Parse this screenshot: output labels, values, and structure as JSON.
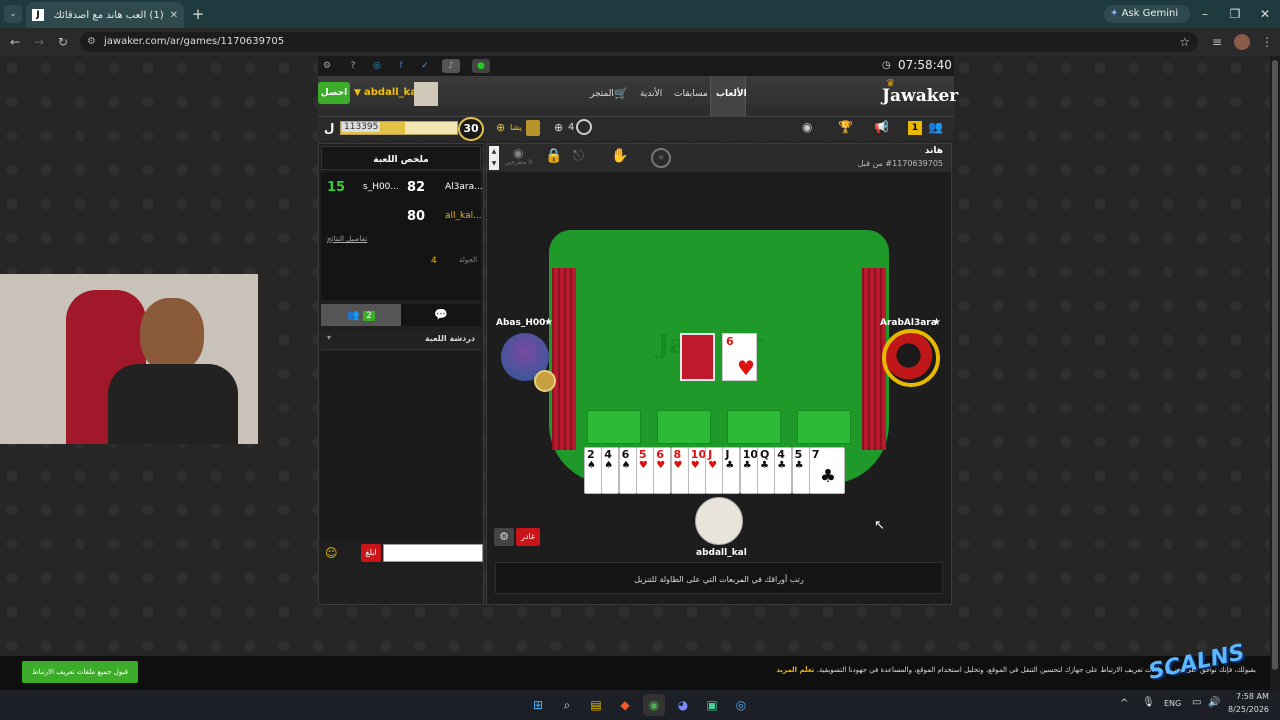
{
  "browser": {
    "tab_title": "(1) العب هاند مع أصدقائك",
    "tab_counter": "J",
    "url": "jawaker.com/ar/games/1170639705",
    "ask_gemini": "Ask Gemini"
  },
  "site": {
    "clock": "07:58:40",
    "logo": "Jawaker",
    "nav": [
      "الألعاب",
      "مسابقات",
      "الأندية",
      "المتجر"
    ],
    "username": "abdall_kal",
    "get_button": "احصل",
    "level": "30",
    "xp": "113395",
    "xp_progress": 0.55,
    "coins_label": "يشا",
    "tokens": "4",
    "notif_count": "1"
  },
  "sidebar": {
    "summary_title": "ملخص اللعبة",
    "scores": [
      {
        "left_name": "s_H00...",
        "left_score": "82",
        "right_name": "Al3ara...",
        "right_score": "15"
      },
      {
        "left_name": "all_kal...",
        "left_score": "80"
      }
    ],
    "details_link": "تفاصيل النتائج",
    "round_label": "الجولة",
    "round_value": "4",
    "friends_count": "2",
    "chat_title": "دردشة اللعبة",
    "report_button": "ابلغ"
  },
  "game": {
    "name": "هاند",
    "id": "#1170639705 من قبل",
    "spectators": "0 متفرجين",
    "player_left": "Abas_H00",
    "player_right": "ArabAl3ara",
    "player_bottom": "abdall_kal",
    "center_card": {
      "rank": "6",
      "suit": "♥"
    },
    "hand": [
      {
        "rank": "2",
        "suit": "♠",
        "color": "black"
      },
      {
        "rank": "4",
        "suit": "♠",
        "color": "black"
      },
      {
        "rank": "6",
        "suit": "♠",
        "color": "black"
      },
      {
        "rank": "5",
        "suit": "♥",
        "color": "red"
      },
      {
        "rank": "6",
        "suit": "♥",
        "color": "red"
      },
      {
        "rank": "8",
        "suit": "♥",
        "color": "red"
      },
      {
        "rank": "10",
        "suit": "♥",
        "color": "red"
      },
      {
        "rank": "J",
        "suit": "♥",
        "color": "red"
      },
      {
        "rank": "J",
        "suit": "♣",
        "color": "black"
      },
      {
        "rank": "10",
        "suit": "♣",
        "color": "black"
      },
      {
        "rank": "Q",
        "suit": "♣",
        "color": "black"
      },
      {
        "rank": "4",
        "suit": "♣",
        "color": "black"
      },
      {
        "rank": "5",
        "suit": "♣",
        "color": "black"
      },
      {
        "rank": "7",
        "suit": "♣",
        "color": "black"
      }
    ],
    "leave_button": "غادر",
    "hint": "رتب أوراقك في المربعات التي على الطاولة للتنزيل"
  },
  "cookie": {
    "text": "بقبولك، فإنك توافق على تخزين ملفات تعريف الارتباط على جهازك لتحسين التنقل في الموقع، وتحليل استخدام الموقع، والمساعدة في جهودنا التسويقية.",
    "learn_more": "تعلّم المزيد",
    "accept": "قبول جميع ملفات تعريف الارتباط"
  },
  "watermark": "SCALNS",
  "taskbar": {
    "lang": "ENG",
    "time": "7:58 AM",
    "date": "8/25/2026"
  }
}
